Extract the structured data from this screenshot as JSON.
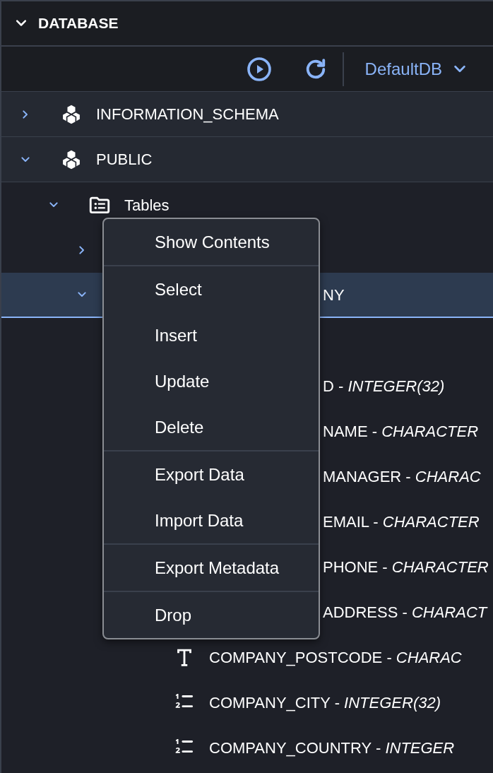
{
  "panel": {
    "title": "DATABASE",
    "expanded": true
  },
  "toolbar": {
    "database": "DefaultDB"
  },
  "tree": [
    {
      "label": "INFORMATION_SCHEMA",
      "kind": "schema",
      "expanded": false,
      "selected": false
    },
    {
      "label": "PUBLIC",
      "kind": "schema",
      "expanded": true,
      "selected": false,
      "children": [
        {
          "label": "Tables",
          "kind": "folder",
          "expanded": true,
          "selected": false,
          "children": [
            {
              "expanded": false,
              "selected": false
            },
            {
              "label": "NY",
              "expanded": true,
              "selected": true,
              "children": [
                {
                  "selected": false,
                  "children": [
                    {
                      "label": "D - *INTEGER(32)*",
                      "selected": false
                    },
                    {
                      "label": "NAME - *CHARACTER*",
                      "selected": false
                    },
                    {
                      "label": "MANAGER - *CHARAC*",
                      "selected": false
                    },
                    {
                      "label": "EMAIL - *CHARACTER*",
                      "selected": false
                    },
                    {
                      "label": "PHONE - *CHARACTER*",
                      "selected": false
                    },
                    {
                      "label": "ADDRESS - *CHARACT*",
                      "selected": false
                    },
                    {
                      "label": "COMPANY_POSTCODE - *CHARAC*",
                      "kind": "text",
                      "selected": false
                    },
                    {
                      "label": "COMPANY_CITY - *INTEGER(32)*",
                      "kind": "number",
                      "selected": false
                    },
                    {
                      "label": "COMPANY_COUNTRY - *INTEGER*",
                      "kind": "number",
                      "selected": false
                    }
                  ]
                }
              ]
            }
          ]
        }
      ]
    }
  ],
  "context_menu": [
    [
      "Show Contents"
    ],
    [
      "Select",
      "Insert",
      "Update",
      "Delete"
    ],
    [
      "Export Data",
      "Import Data"
    ],
    [
      "Export Metadata"
    ],
    [
      "Drop"
    ]
  ]
}
